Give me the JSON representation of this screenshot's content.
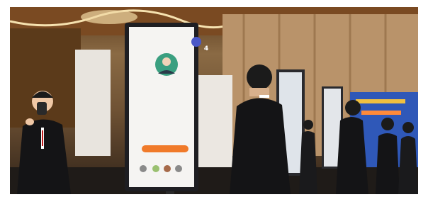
{
  "scene": {
    "colors": {
      "ceiling_wood": "#7a4a22",
      "lights": "#f6e2b0",
      "wall_panel": "#b9936a",
      "suit": "#141416",
      "kiosk_frame": "#1e1e22",
      "kiosk_screen": "#f5f4f2",
      "kiosk_button": "#f07a2a",
      "badge_blue": "#4a58c8",
      "banner_blue": "#2f58b8"
    }
  },
  "kiosk": {
    "badge_number": "4",
    "tab_label": "",
    "person_name": "",
    "person_role": "",
    "info_line": "",
    "button_label": "",
    "icon_labels": ""
  }
}
